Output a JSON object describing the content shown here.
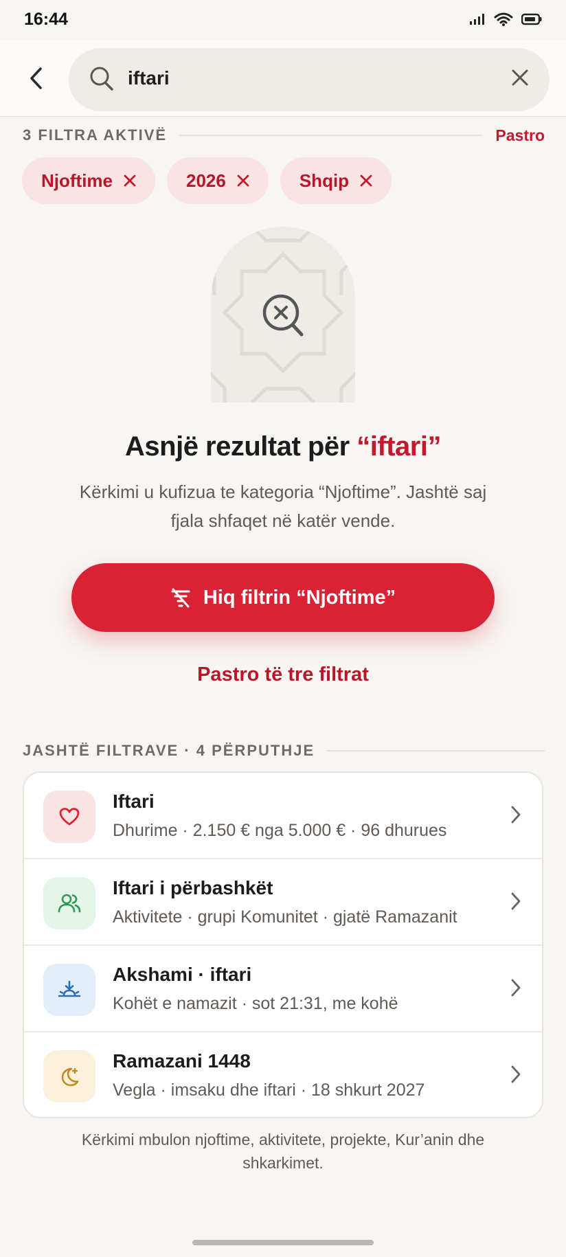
{
  "status": {
    "time": "16:44"
  },
  "search": {
    "query": "iftari"
  },
  "filters": {
    "label": "3 FILTRA AKTIVË",
    "clear_label": "Pastro",
    "chips": [
      "Njoftime",
      "2026",
      "Shqip"
    ]
  },
  "empty": {
    "title_prefix": "Asnjë rezultat për ",
    "title_query": "“iftari”",
    "description": "Kërkimi u kufizua te kategoria “Njoftime”. Jashtë saj fjala shfaqet në katër vende.",
    "cta_label": "Hiq filtrin “Njoftime”",
    "clear_all_label": "Pastro të tre filtrat"
  },
  "outside": {
    "label": "JASHTË FILTRAVE · 4 PËRPUTHJE",
    "items": [
      {
        "title": "Iftari",
        "subtitle": "Dhurime · 2.150 € nga 5.000 € · 96 dhurues",
        "icon": "heart-icon",
        "bg": "#f9e3e3",
        "color": "#d92234"
      },
      {
        "title": "Iftari i përbashkët",
        "subtitle": "Aktivitete · grupi Komunitet · gjatë Ramazanit",
        "icon": "users-icon",
        "bg": "#e3f4e8",
        "color": "#2e9a55"
      },
      {
        "title": "Akshami · iftari",
        "subtitle": "Kohët e namazit · sot 21:31, me kohë",
        "icon": "sunset-icon",
        "bg": "#e2eef9",
        "color": "#2a6fb0"
      },
      {
        "title": "Ramazani 1448",
        "subtitle": "Vegla · imsaku dhe iftari · 18 shkurt 2027",
        "icon": "moon-star-icon",
        "bg": "#fbf0d9",
        "color": "#c08a1e"
      }
    ]
  },
  "footer": "Kërkimi mbulon njoftime, aktivitete, projekte, Kur’anin dhe shkarkimet.",
  "colors": {
    "accent": "#d92234",
    "accent_text": "#c4192c",
    "background": "#f8f6f3"
  }
}
